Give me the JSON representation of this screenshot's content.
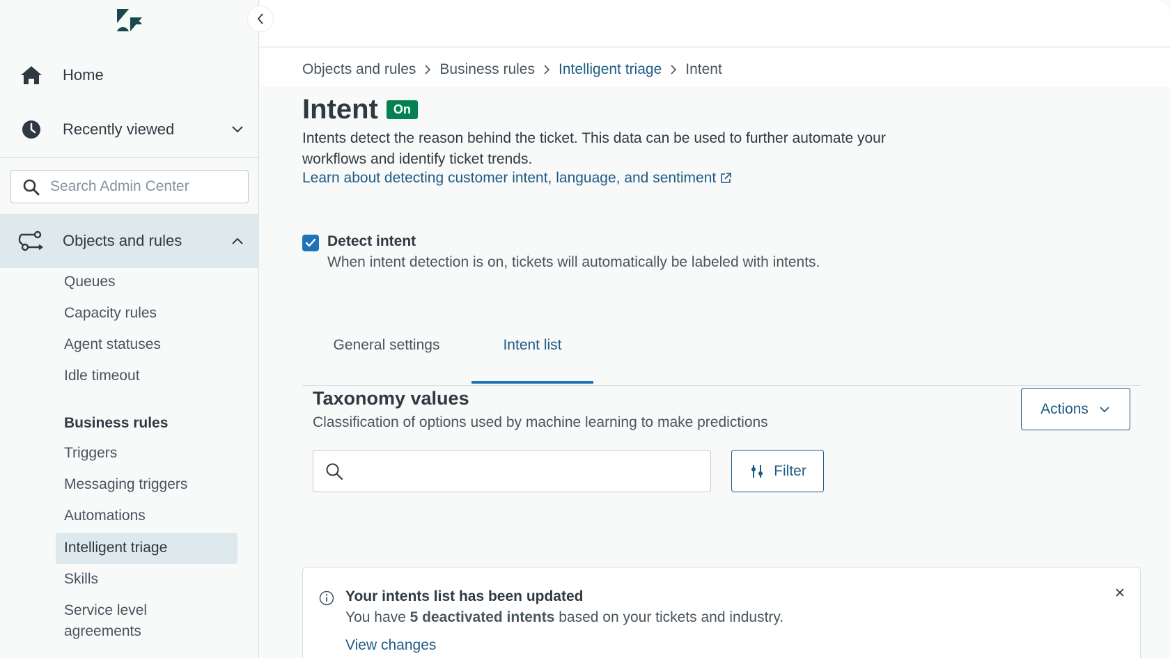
{
  "sidebar": {
    "home_label": "Home",
    "recent_label": "Recently viewed",
    "search_placeholder": "Search Admin Center",
    "objects_label": "Objects and rules",
    "items": [
      {
        "label": "Queues"
      },
      {
        "label": "Capacity rules"
      },
      {
        "label": "Agent statuses"
      },
      {
        "label": "Idle timeout"
      }
    ],
    "business_rules_header": "Business rules",
    "business_items": [
      {
        "label": "Triggers"
      },
      {
        "label": "Messaging triggers"
      },
      {
        "label": "Automations"
      },
      {
        "label": "Intelligent triage"
      },
      {
        "label": "Skills"
      },
      {
        "label": "Service level agreements"
      }
    ],
    "icons": {
      "logo": "zendesk-logo",
      "home": "home-icon",
      "recent": "clock-icon",
      "search": "search-icon",
      "objects": "objects-rules-icon",
      "collapse": "chevron-left-icon"
    }
  },
  "breadcrumb": {
    "items": [
      "Objects and rules",
      "Business rules",
      "Intelligent triage",
      "Intent"
    ]
  },
  "page": {
    "title": "Intent",
    "status_badge": "On",
    "description": "Intents detect the reason behind the ticket. This data can be used to further automate your workflows and identify ticket trends.",
    "learn_link": "Learn about detecting customer intent, language, and sentiment",
    "detect_label": "Detect intent",
    "detect_hint": "When intent detection is on, tickets will automatically be labeled with intents.",
    "detect_checked": true
  },
  "tabs": [
    {
      "label": "General settings",
      "active": false
    },
    {
      "label": "Intent list",
      "active": true
    }
  ],
  "taxonomy": {
    "title": "Taxonomy values",
    "subtitle": "Classification of options used by machine learning to make predictions",
    "actions_label": "Actions",
    "filter_label": "Filter",
    "search_placeholder": ""
  },
  "notice": {
    "title": "Your intents list has been updated",
    "body_prefix": "You have ",
    "body_bold": "5 deactivated intents",
    "body_suffix": " based on your tickets and industry.",
    "link": "View changes"
  },
  "colors": {
    "accent": "#1f73b7",
    "link": "#1d5b86",
    "badge_green": "#038153",
    "active_bg": "#dde9ec"
  }
}
